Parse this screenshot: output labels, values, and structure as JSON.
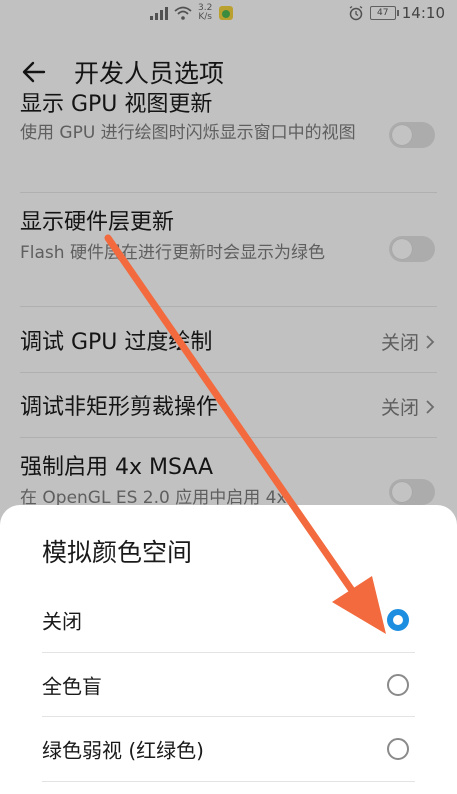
{
  "status_bar": {
    "net_speed_value": "3.2",
    "net_speed_unit": "K/s",
    "battery": "47",
    "time": "14:10",
    "icons": [
      "signal-icon",
      "wifi-icon",
      "app-notification-icon",
      "alarm-icon",
      "battery-icon"
    ]
  },
  "app_bar": {
    "title": "开发人员选项",
    "back_icon": "back-arrow-icon"
  },
  "settings": {
    "gpu_view_updates": {
      "title": "显示 GPU 视图更新",
      "desc": "使用 GPU 进行绘图时闪烁显示窗口中的视图"
    },
    "hardware_layers": {
      "title": "显示硬件层更新",
      "desc": "Flash 硬件层在进行更新时会显示为绿色"
    },
    "gpu_overdraw": {
      "title": "调试 GPU 过度绘制",
      "value": "关闭"
    },
    "non_rect_clip": {
      "title": "调试非矩形剪裁操作",
      "value": "关闭"
    },
    "msaa": {
      "title": "强制启用 4x MSAA",
      "desc": "在 OpenGL ES 2.0 应用中启用 4x"
    }
  },
  "dialog": {
    "title": "模拟颜色空间",
    "options": [
      {
        "label": "关闭",
        "selected": true
      },
      {
        "label": "全色盲",
        "selected": false
      },
      {
        "label": "绿色弱视 (红绿色)",
        "selected": false
      }
    ]
  },
  "colors": {
    "accent": "#1e8fe0",
    "annotation_arrow": "#f26a3d"
  }
}
